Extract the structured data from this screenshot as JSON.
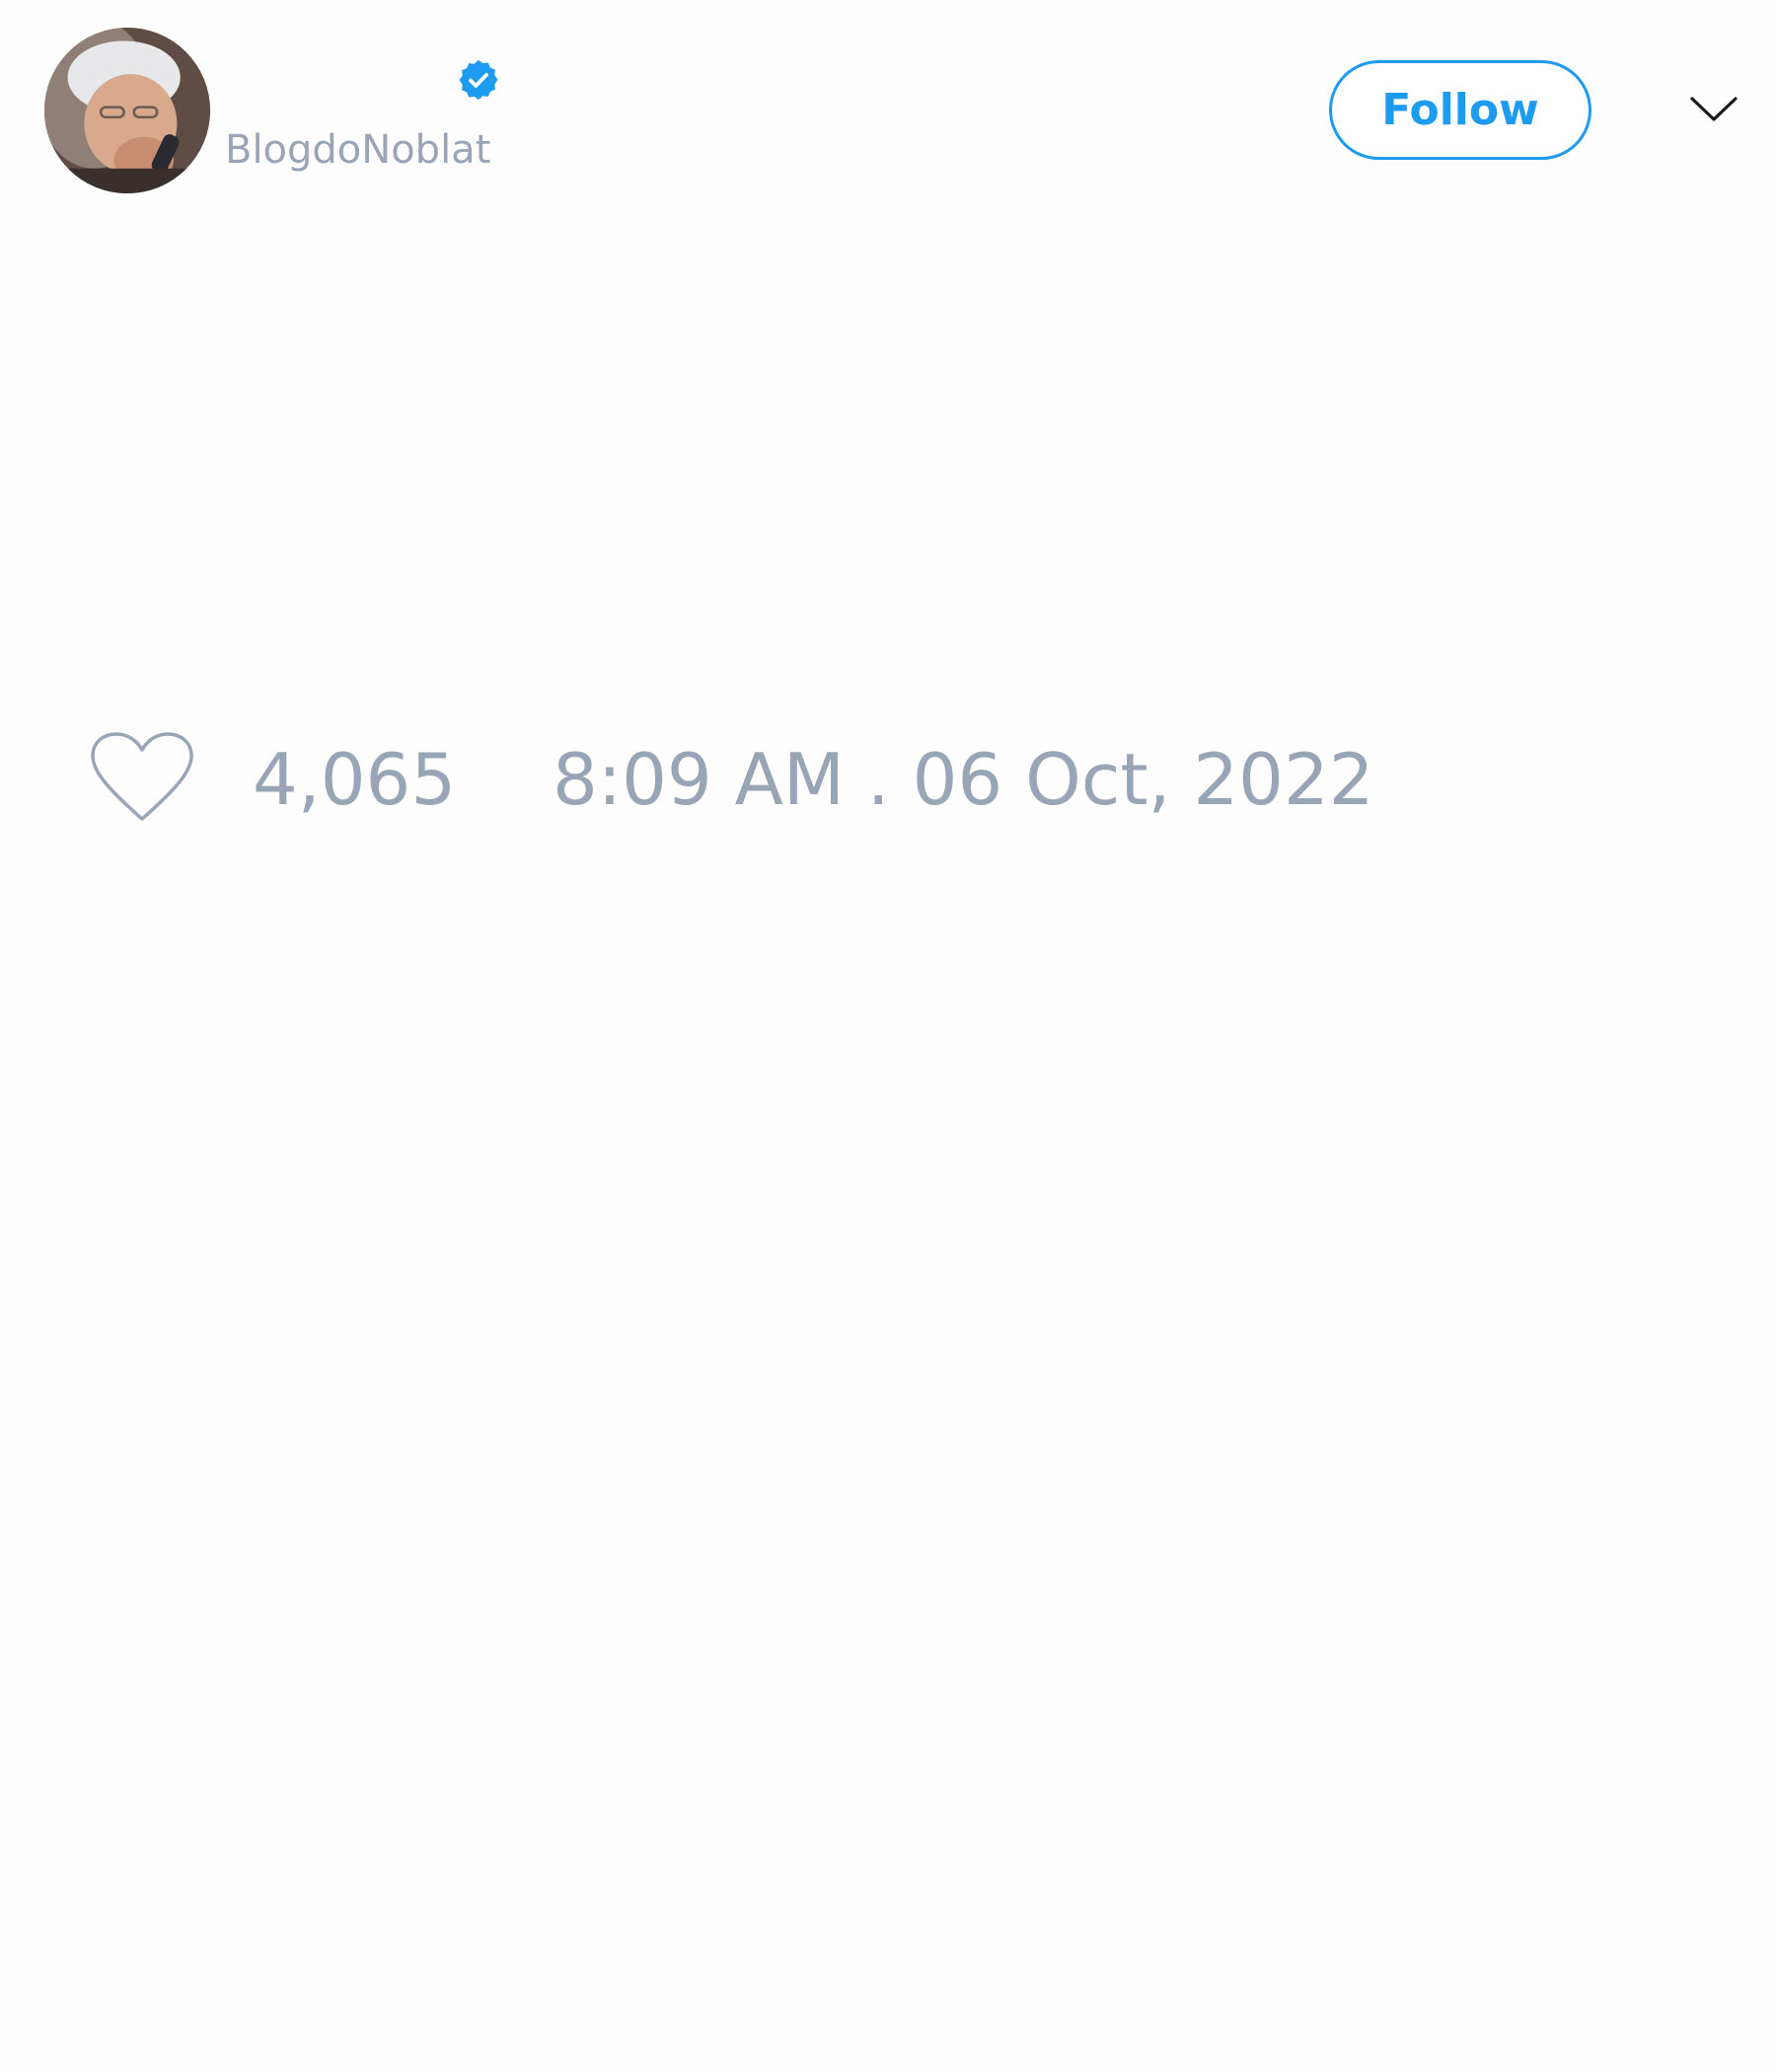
{
  "tweet": {
    "author": {
      "handle": "BlogdoNoblat",
      "verified": true,
      "avatar_icon": "profile-photo"
    },
    "header": {
      "follow_label": "Follow",
      "menu_icon": "chevron-down-icon"
    },
    "footer": {
      "like_icon": "heart-outline-icon",
      "like_count": "4,065",
      "timestamp": "8:09 AM . 06 Oct, 2022"
    }
  },
  "colors": {
    "accent": "#1d9bf0",
    "muted_text": "#98a5b7",
    "background": "#fefefe"
  }
}
